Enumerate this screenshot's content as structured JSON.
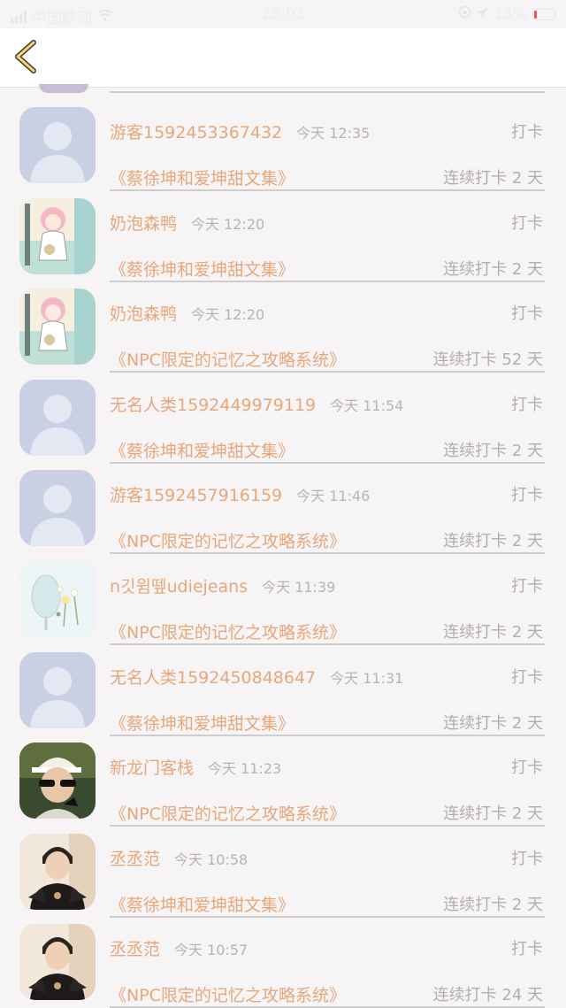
{
  "status_bar": {
    "carrier": "中国移动",
    "time": "23:03",
    "battery": "13%"
  },
  "colors": {
    "name": "#e6a77b",
    "meta": "#b3aeb0",
    "back_arrow": "#f0d86a"
  },
  "icons": {
    "back": "chevron-left-icon"
  },
  "rows": [
    {
      "avatar": "default-user",
      "name": "游客1592453367432",
      "time": "今天 12:35",
      "action": "打卡",
      "book": "《蔡徐坤和爱坤甜文集》",
      "streak": "连续打卡 2 天"
    },
    {
      "avatar": "anime-girl",
      "name": "奶泡森鸭",
      "time": "今天 12:20",
      "action": "打卡",
      "book": "《蔡徐坤和爱坤甜文集》",
      "streak": "连续打卡 2 天"
    },
    {
      "avatar": "anime-girl",
      "name": "奶泡森鸭",
      "time": "今天 12:20",
      "action": "打卡",
      "book": "《NPC限定的记忆之攻略系统》",
      "streak": "连续打卡 52 天"
    },
    {
      "avatar": "default-user",
      "name": "无名人类1592449979119",
      "time": "今天 11:54",
      "action": "打卡",
      "book": "《蔡徐坤和爱坤甜文集》",
      "streak": "连续打卡 2 天"
    },
    {
      "avatar": "default-user",
      "name": "游客1592457916159",
      "time": "今天 11:46",
      "action": "打卡",
      "book": "《NPC限定的记忆之攻略系统》",
      "streak": "连续打卡 2 天"
    },
    {
      "avatar": "flower-glass",
      "name": "n깃윔뗖udiejeans",
      "time": "今天 11:39",
      "action": "打卡",
      "book": "《NPC限定的记忆之攻略系统》",
      "streak": "连续打卡 2 天"
    },
    {
      "avatar": "default-user",
      "name": "无名人类1592450848647",
      "time": "今天 11:31",
      "action": "打卡",
      "book": "《蔡徐坤和爱坤甜文集》",
      "streak": "连续打卡 2 天"
    },
    {
      "avatar": "cap-boy",
      "name": "新龙门客栈",
      "time": "今天 11:23",
      "action": "打卡",
      "book": "《NPC限定的记忆之攻略系统》",
      "streak": "连续打卡 2 天"
    },
    {
      "avatar": "boy-photo",
      "name": "丞丞范",
      "time": "今天 10:58",
      "action": "打卡",
      "book": "《蔡徐坤和爱坤甜文集》",
      "streak": "连续打卡 2 天"
    },
    {
      "avatar": "boy-photo",
      "name": "丞丞范",
      "time": "今天 10:57",
      "action": "打卡",
      "book": "《NPC限定的记忆之攻略系统》",
      "streak": "连续打卡 24 天"
    }
  ]
}
